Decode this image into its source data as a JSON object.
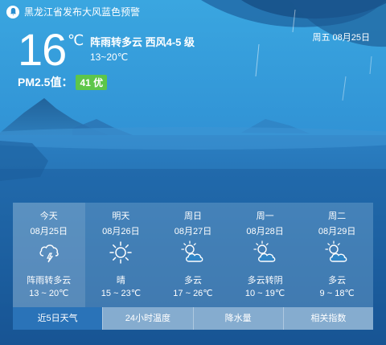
{
  "alert": {
    "text": "黑龙江省发布大风蓝色预警"
  },
  "current": {
    "date": "周五 08月25日",
    "temperature": "16",
    "unit": "℃",
    "condition": "阵雨转多云 西风4-5 级",
    "range": "13~20℃",
    "pm_label": "PM2.5值：",
    "pm_value": "41 优"
  },
  "colors": {
    "pm_badge": "#5dc64a",
    "active_tab": "#2a73b8",
    "sky": "#2b8fd0"
  },
  "forecast": [
    {
      "name": "今天",
      "date": "08月25日",
      "icon": "thunder-shower-icon",
      "desc": "阵雨转多云",
      "range": "13 ~ 20℃"
    },
    {
      "name": "明天",
      "date": "08月26日",
      "icon": "sun-icon",
      "desc": "晴",
      "range": "15 ~ 23℃"
    },
    {
      "name": "周日",
      "date": "08月27日",
      "icon": "partly-cloudy-icon",
      "desc": "多云",
      "range": "17 ~ 26℃"
    },
    {
      "name": "周一",
      "date": "08月28日",
      "icon": "partly-cloudy-icon",
      "desc": "多云转阴",
      "range": "10 ~ 19℃"
    },
    {
      "name": "周二",
      "date": "08月29日",
      "icon": "partly-cloudy-icon",
      "desc": "多云",
      "range": "9 ~ 18℃"
    }
  ],
  "tabs": [
    "近5日天气",
    "24小时温度",
    "降水量",
    "相关指数"
  ]
}
